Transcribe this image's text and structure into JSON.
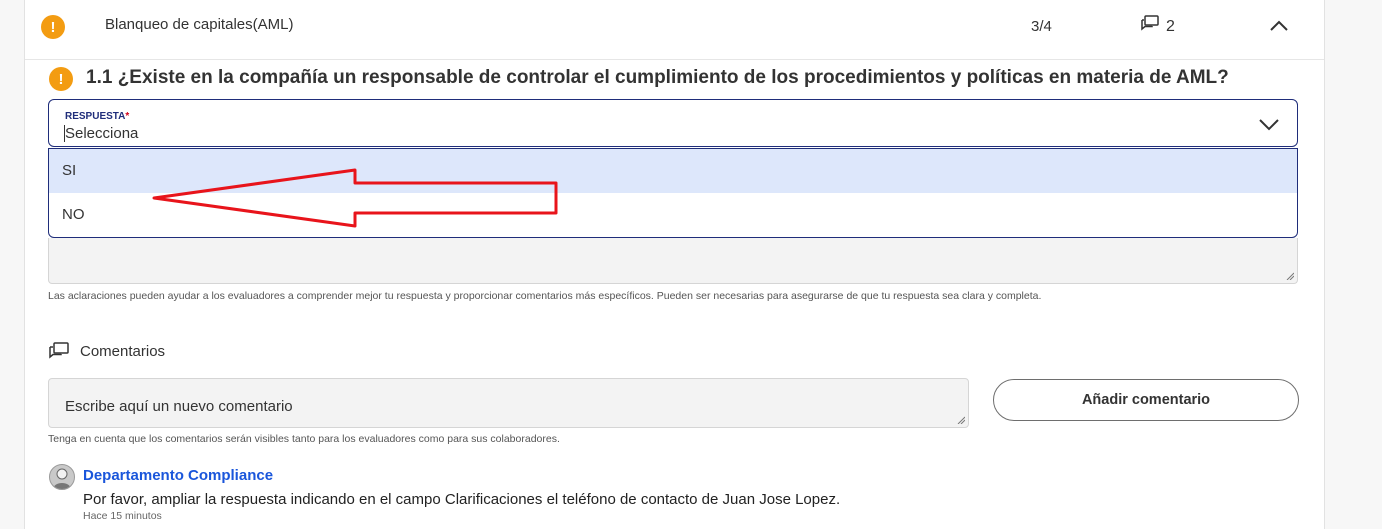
{
  "section": {
    "title": "Blanqueo de capitales(AML)",
    "progress": "3/4",
    "comments_count": "2"
  },
  "question": {
    "text": "1.1 ¿Existe en la compañía un responsable de controlar el cumplimiento de los procedimientos y políticas en materia de AML?"
  },
  "answer_select": {
    "label": "RESPUESTA",
    "required_mark": "*",
    "value": "Selecciona",
    "options": [
      "SI",
      "NO"
    ]
  },
  "clarifications": {
    "hint": "Las aclaraciones pueden ayudar a los evaluadores a comprender mejor tu respuesta y proporcionar comentarios más específicos. Pueden ser necesarias para asegurarse de que tu respuesta sea clara y completa."
  },
  "comments": {
    "heading": "Comentarios",
    "input_placeholder": "Escribe aquí un nuevo comentario",
    "add_button": "Añadir comentario",
    "visibility_hint": "Tenga en cuenta que los comentarios serán visibles tanto para los evaluadores como para sus colaboradores.",
    "items": [
      {
        "author": "Departamento Compliance",
        "text": "Por favor, ampliar la respuesta indicando en el campo Clarificaciones el teléfono de contacto de Juan Jose Lopez.",
        "time": "Hace 15 minutos"
      }
    ]
  },
  "colors": {
    "warning": "#f39c12",
    "accent_border": "#1f2d7a",
    "option_highlight": "#dde7fb",
    "link": "#1a56db",
    "annotation_arrow": "#e8141b"
  },
  "icons": {
    "section_status": "warning-icon",
    "question_status": "warning-icon",
    "comments": "chat-bubbles-icon",
    "collapse": "chevron-up-icon",
    "select": "chevron-down-icon"
  }
}
